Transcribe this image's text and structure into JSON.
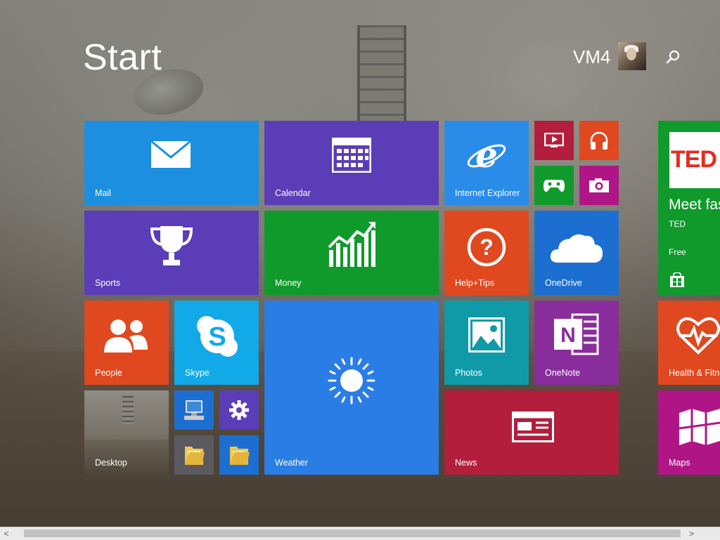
{
  "header": {
    "title": "Start",
    "user_name": "VM4"
  },
  "tiles": {
    "mail": {
      "label": "Mail",
      "color": "#1c8fe0"
    },
    "calendar": {
      "label": "Calendar",
      "color": "#5b3db7"
    },
    "ie": {
      "label": "Internet Explorer",
      "color": "#2a8ce8"
    },
    "video": {
      "color": "#b21e3c"
    },
    "music": {
      "color": "#e0481f"
    },
    "games": {
      "color": "#109a2c"
    },
    "camera": {
      "color": "#b01586"
    },
    "ted": {
      "title_text": "Meet fas",
      "publisher": "TED",
      "price": "Free",
      "logo": "TED",
      "color": "#109a2c"
    },
    "sports": {
      "label": "Sports",
      "color": "#5b3db7"
    },
    "money": {
      "label": "Money",
      "color": "#109a2c"
    },
    "help": {
      "label": "Help+Tips",
      "color": "#e0481f"
    },
    "onedrive": {
      "label": "OneDrive",
      "color": "#1c6fd0"
    },
    "people": {
      "label": "People",
      "color": "#e0481f"
    },
    "skype": {
      "label": "Skype",
      "color": "#12a9e8"
    },
    "weather": {
      "label": "Weather",
      "color": "#2a7de4"
    },
    "photos": {
      "label": "Photos",
      "color": "#0f9aa8"
    },
    "onenote": {
      "label": "OneNote",
      "color": "#8a2d9c"
    },
    "health": {
      "label": "Health & Fitne",
      "color": "#e0481f"
    },
    "desktop": {
      "label": "Desktop"
    },
    "computer": {
      "color": "#1c6fd0"
    },
    "settings": {
      "color": "#5b3db7"
    },
    "explorer": {
      "color": "#5a5a60"
    },
    "explorer2": {
      "color": "#1c6fd0"
    },
    "news": {
      "label": "News",
      "color": "#b21e3c"
    },
    "maps": {
      "label": "Maps",
      "color": "#b01586"
    }
  },
  "scrollbar": {
    "left_arrow": "<",
    "right_arrow": ">"
  }
}
